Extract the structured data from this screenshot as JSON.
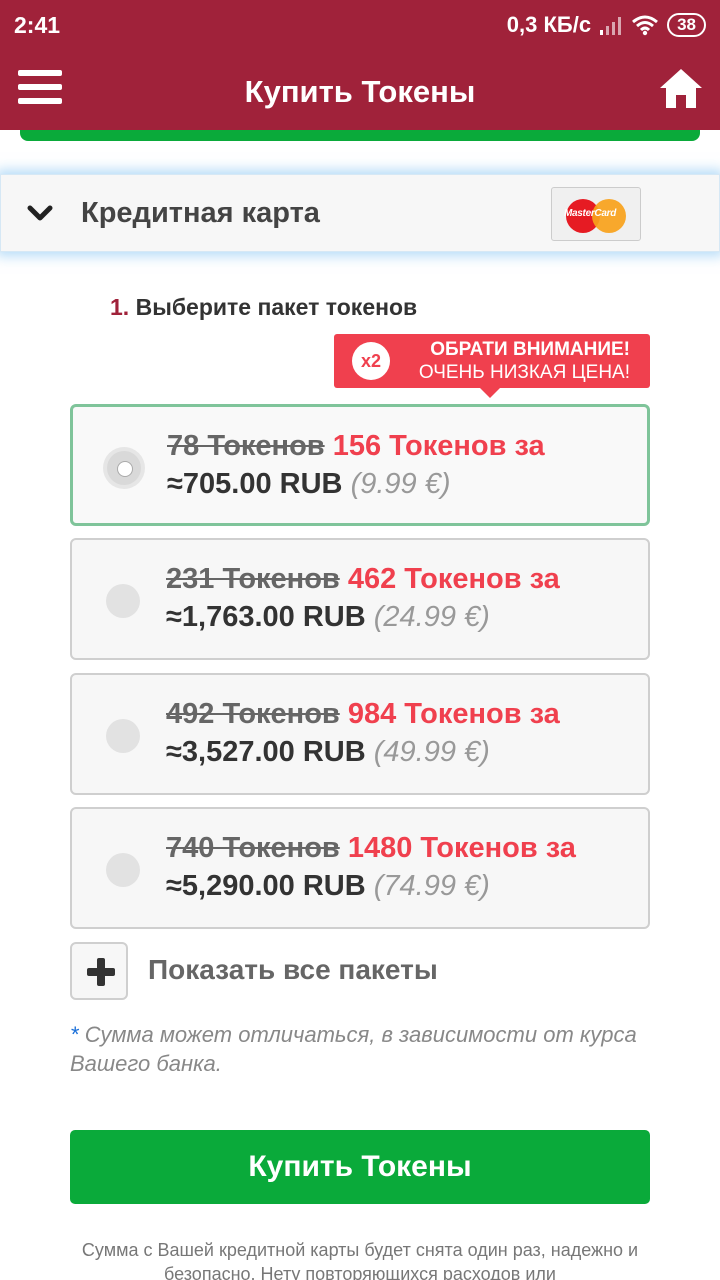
{
  "status_bar": {
    "time": "2:41",
    "network_speed": "0,3 КБ/с",
    "battery": "38",
    "icons": [
      "signal-icon",
      "wifi-icon",
      "battery-icon"
    ]
  },
  "app_bar": {
    "title": "Купить Токены",
    "menu_icon": "hamburger-menu-icon",
    "home_icon": "home-icon",
    "background": "#a0223a"
  },
  "payment_method": {
    "label": "Кредитная карта",
    "logo_text": "MasterCard"
  },
  "step": {
    "number": "1.",
    "title": "Выберите пакет токенов"
  },
  "promo": {
    "badge": "x2",
    "line1": "ОБРАТИ ВНИМАНИЕ!",
    "line2": "ОЧЕНЬ НИЗКАЯ ЦЕНА!",
    "color": "#f0404e"
  },
  "packages": [
    {
      "old": "78 Токенов",
      "new": "156 Токенов за",
      "price": "≈705.00 RUB",
      "eur": "(9.99 €)",
      "selected": true
    },
    {
      "old": "231 Токенов",
      "new": "462 Токенов за",
      "price": "≈1,763.00 RUB",
      "eur": "(24.99 €)",
      "selected": false
    },
    {
      "old": "492 Токенов",
      "new": "984 Токенов за",
      "price": "≈3,527.00 RUB",
      "eur": "(49.99 €)",
      "selected": false
    },
    {
      "old": "740 Токенов",
      "new": "1480 Токенов за",
      "price": "≈5,290.00 RUB",
      "eur": "(74.99 €)",
      "selected": false
    }
  ],
  "show_all": "Показать все пакеты",
  "note": {
    "asterisk": "*",
    "text": "Сумма может отличаться, в зависимости от курса Вашего банка."
  },
  "buy_button": "Купить Токены",
  "footer_note": "Сумма с Вашей кредитной карты будет снята один раз, надежно и безопасно. Нету повторяющихся расходов или",
  "colors": {
    "accent_green": "#0aaa3a",
    "price_red": "#f0404e",
    "selected_border": "#7fc49a"
  }
}
